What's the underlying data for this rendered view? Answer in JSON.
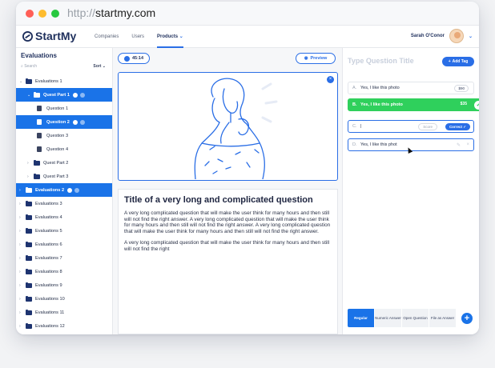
{
  "browser": {
    "url_protocol": "http://",
    "url_host": "startmy.com"
  },
  "app": {
    "logo": "StartMy",
    "nav": [
      {
        "label": "Companies"
      },
      {
        "label": "Users"
      },
      {
        "label": "Products",
        "active": true
      }
    ],
    "user_name": "Sarah O'Conor"
  },
  "sidebar": {
    "title": "Evaluations",
    "search_placeholder": "Search",
    "sort_label": "Sort",
    "tree": [
      {
        "label": "Evaluations 1",
        "level": 0,
        "type": "folder",
        "expanded": true
      },
      {
        "label": "Quest Part 1",
        "level": 1,
        "type": "folder",
        "selected": true,
        "expanded": true
      },
      {
        "label": "Question 1",
        "level": 2,
        "type": "doc"
      },
      {
        "label": "Question 2",
        "level": 2,
        "type": "doc",
        "selected": true
      },
      {
        "label": "Question 3",
        "level": 2,
        "type": "doc"
      },
      {
        "label": "Question 4",
        "level": 2,
        "type": "doc"
      },
      {
        "label": "Quest Part 2",
        "level": 1,
        "type": "folder"
      },
      {
        "label": "Quest Part 3",
        "level": 1,
        "type": "folder"
      },
      {
        "label": "Evaluations 2",
        "level": 0,
        "type": "folder",
        "selected": true
      },
      {
        "label": "Evaluations 3",
        "level": 0,
        "type": "folder"
      },
      {
        "label": "Evaluations 4",
        "level": 0,
        "type": "folder"
      },
      {
        "label": "Evaluations 5",
        "level": 0,
        "type": "folder"
      },
      {
        "label": "Evaluations 6",
        "level": 0,
        "type": "folder"
      },
      {
        "label": "Evaluations 7",
        "level": 0,
        "type": "folder"
      },
      {
        "label": "Evaluations 8",
        "level": 0,
        "type": "folder"
      },
      {
        "label": "Evaluations 9",
        "level": 0,
        "type": "folder"
      },
      {
        "label": "Evaluations 10",
        "level": 0,
        "type": "folder"
      },
      {
        "label": "Evaluations 11",
        "level": 0,
        "type": "folder"
      },
      {
        "label": "Evaluations 12",
        "level": 0,
        "type": "folder"
      }
    ]
  },
  "center": {
    "timer": "45:14",
    "preview_label": "Preview",
    "question_title": "Title of a very long and complicated question",
    "question_para1": "A very long complicated question that will make the user think for many hours and then still will not find the right answer. A very long complicated question that will make the user think for many hours and then still will not find the right answer. A very long complicated question that will make the user think for many hours and then still will not find the right answer.",
    "question_para2": "A very long complicated question that will make the user think for many hours and then still will not find the right"
  },
  "right": {
    "title_placeholder": "Type Question Title",
    "add_tag_label": "Add Tag",
    "answers": [
      {
        "letter": "A.",
        "text": "Yes, I like this photo",
        "score": "$90"
      },
      {
        "letter": "B.",
        "text": "Yes, I like this photo",
        "score": "$35"
      },
      {
        "letter": "C.",
        "text": "|",
        "score_placeholder": "Score",
        "correct_label": "Correct"
      },
      {
        "letter": "D.",
        "text": "Yes, I like this phot"
      }
    ],
    "types": [
      "Regular",
      "Numeric Answer",
      "Open Question",
      "File as Answer"
    ],
    "colors": {
      "accent": "#1a73e8",
      "correct": "#2fd05c"
    }
  }
}
